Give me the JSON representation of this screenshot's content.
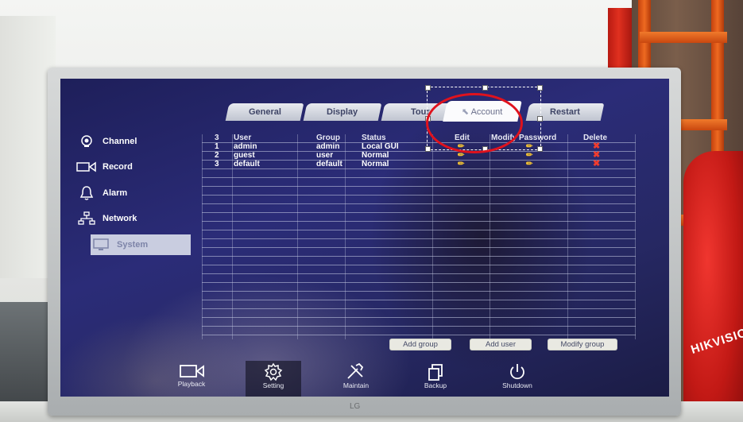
{
  "background": {
    "bag_brand": "HIKVISIO",
    "tv_brand": "LG"
  },
  "sidebar": {
    "items": [
      {
        "label": "Channel",
        "icon": "camera-icon"
      },
      {
        "label": "Record",
        "icon": "video-record-icon"
      },
      {
        "label": "Alarm",
        "icon": "bell-icon"
      },
      {
        "label": "Network",
        "icon": "network-icon"
      },
      {
        "label": "System",
        "icon": "monitor-icon",
        "active": true
      }
    ]
  },
  "tabs": [
    {
      "label": "General"
    },
    {
      "label": "Display"
    },
    {
      "label": "Tour"
    },
    {
      "label": "Account",
      "active": true
    },
    {
      "label": "Restart"
    }
  ],
  "table": {
    "headers": {
      "count": "3",
      "user": "User",
      "group": "Group",
      "status": "Status",
      "edit": "Edit",
      "modify_password": "Modify Password",
      "delete": "Delete"
    },
    "rows": [
      {
        "no": "1",
        "user": "admin",
        "group": "admin",
        "status": "Local GUI"
      },
      {
        "no": "2",
        "user": "guest",
        "group": "user",
        "status": "Normal"
      },
      {
        "no": "3",
        "user": "default",
        "group": "default",
        "status": "Normal"
      }
    ]
  },
  "buttons": {
    "add_group": "Add group",
    "add_user": "Add user",
    "modify_group": "Modify group"
  },
  "dock": [
    {
      "label": "Playback",
      "icon": "playback-camera-icon"
    },
    {
      "label": "Setting",
      "icon": "gear-icon",
      "selected": true
    },
    {
      "label": "Maintain",
      "icon": "tools-icon"
    },
    {
      "label": "Backup",
      "icon": "backup-icon"
    },
    {
      "label": "Shutdown",
      "icon": "power-icon"
    }
  ],
  "colors": {
    "screen_bg": "#262863",
    "edit_icon": "#f2c232",
    "delete_icon": "#f03c2e",
    "annotation_ellipse": "#e0121d"
  }
}
